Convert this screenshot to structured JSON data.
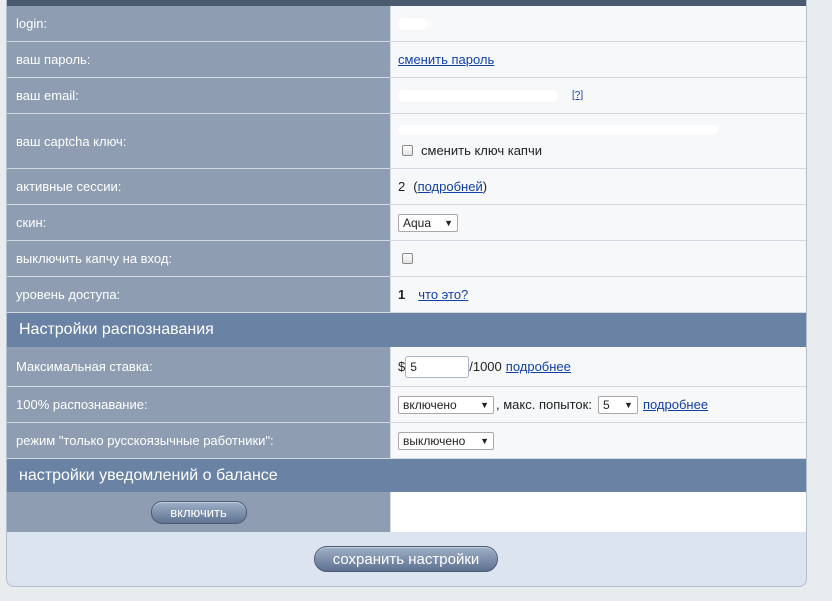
{
  "account": {
    "login_label": "login:",
    "password_label": "ваш пароль:",
    "password_link": "сменить пароль",
    "email_label": "ваш email:",
    "email_help": "[?]",
    "captcha_key_label": "ваш captcha ключ:",
    "captcha_change_label": "сменить ключ капчи",
    "sessions_label": "активные сессии:",
    "sessions_count": "2",
    "sessions_open_paren": "(",
    "sessions_link": "подробней",
    "sessions_close_paren": ")",
    "skin_label": "скин:",
    "skin_value": "Aqua",
    "disable_captcha_label": "выключить капчу на вход:",
    "access_level_label": "уровень доступа:",
    "access_level_value": "1",
    "access_level_link": "что это?"
  },
  "recognition": {
    "section_title": "Настройки распознавания",
    "max_bid_label": "Максимальная ставка:",
    "currency": "$",
    "max_bid_value": "5",
    "max_bid_suffix": "/1000",
    "max_bid_link": "подробнее",
    "full_recognition_label": "100% распознавание:",
    "full_recognition_value": "включено",
    "max_attempts_label": ", макс. попыток:",
    "max_attempts_value": "5",
    "full_recognition_link": "подробнее",
    "russian_only_label": "режим \"только русскоязычные работники\":",
    "russian_only_value": "выключено"
  },
  "balance": {
    "section_title": "настройки уведомлений о балансе",
    "enable_button": "включить"
  },
  "save_button": "сохранить настройки"
}
